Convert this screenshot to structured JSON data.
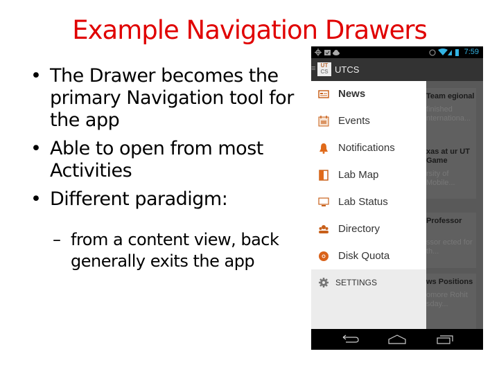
{
  "slide": {
    "title": "Example Navigation Drawers",
    "bullets": [
      {
        "marker": "•",
        "text": "The Drawer becomes the primary Navigation tool for the app"
      },
      {
        "marker": "•",
        "text": "Able to open from most Activities"
      },
      {
        "marker": "•",
        "text": "Different paradigm:"
      }
    ],
    "sub_bullets": [
      {
        "marker": "–",
        "text": "from a content view, back generally exits the app"
      }
    ]
  },
  "phone": {
    "status_bar": {
      "left_icons": [
        "gps-icon",
        "calendar-check-icon",
        "cloud-icon"
      ],
      "right_icons": [
        "alarm-icon",
        "wifi-icon",
        "signal-icon",
        "battery-icon"
      ],
      "time": "7:59"
    },
    "action_bar": {
      "logo_line1": "UT",
      "logo_line2": "CS",
      "title": "UTCS"
    },
    "drawer": {
      "items": [
        {
          "label": "News",
          "icon": "news-icon",
          "active": true
        },
        {
          "label": "Events",
          "icon": "calendar-icon",
          "active": false
        },
        {
          "label": "Notifications",
          "icon": "bell-icon",
          "active": false
        },
        {
          "label": "Lab Map",
          "icon": "door-map-icon",
          "active": false
        },
        {
          "label": "Lab Status",
          "icon": "monitor-icon",
          "active": false
        },
        {
          "label": "Directory",
          "icon": "people-icon",
          "active": false
        },
        {
          "label": "Disk Quota",
          "icon": "disk-icon",
          "active": false
        }
      ],
      "settings_label": "SETTINGS"
    },
    "content_cards": [
      {
        "title": "Team egional",
        "snippet": "finished nternationa..."
      },
      {
        "title": "xas at ur UT Game",
        "snippet": "rsity of Mobile..."
      },
      {
        "title": "Professor",
        "snippet": "ssor ected for th..."
      },
      {
        "title": "ws Positions",
        "snippet": "omore Rohit sday..."
      }
    ],
    "colors": {
      "accent": "#c8601a",
      "status_blue": "#33b5e5"
    }
  }
}
